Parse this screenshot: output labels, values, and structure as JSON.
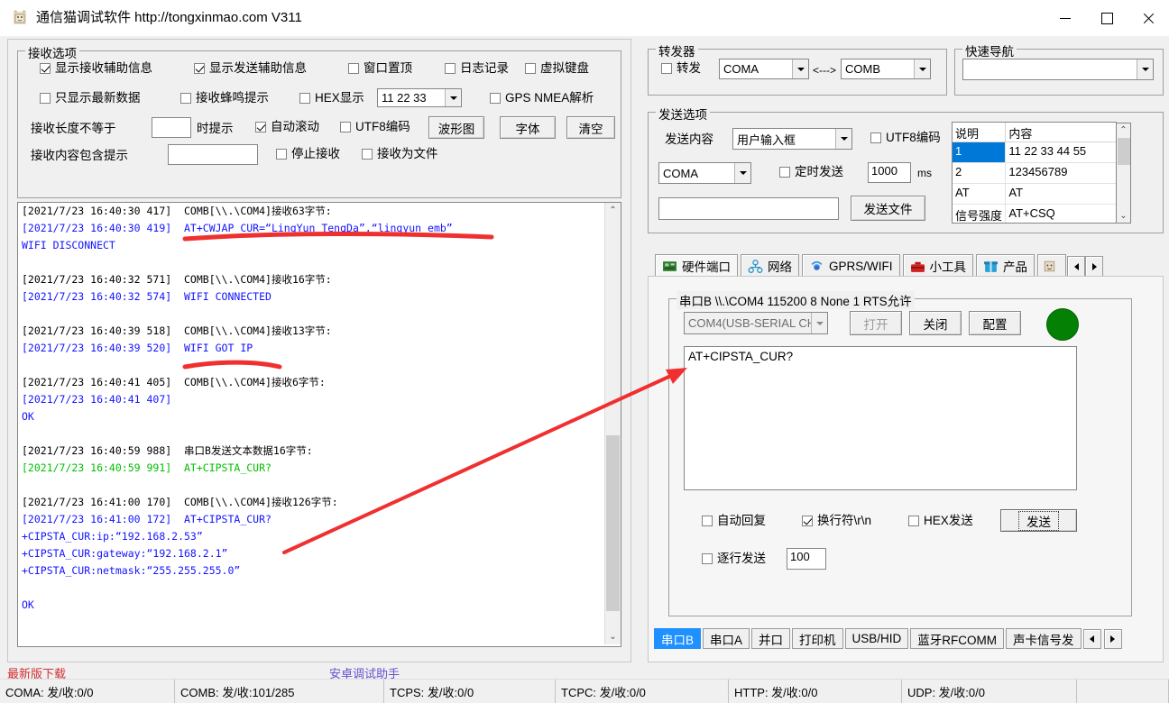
{
  "window": {
    "title": "通信猫调试软件 http://tongxinmao.com V311",
    "icon": "app-cat-icon",
    "minimize": "—",
    "maximize": "□",
    "close": "✕"
  },
  "receive_options": {
    "legend": "接收选项",
    "checkboxes_row1": [
      {
        "label": "显示接收辅助信息",
        "checked": true
      },
      {
        "label": "显示发送辅助信息",
        "checked": true
      },
      {
        "label": "窗口置顶",
        "checked": false
      },
      {
        "label": "日志记录",
        "checked": false
      },
      {
        "label": "虚拟键盘",
        "checked": false
      }
    ],
    "checkboxes_row2": [
      {
        "label": "只显示最新数据",
        "checked": false
      },
      {
        "label": "接收蜂鸣提示",
        "checked": false
      },
      {
        "label": "HEX显示",
        "checked": false
      },
      {
        "label": "GPS NMEA解析",
        "checked": false
      }
    ],
    "hex_combo_value": "11 22 33",
    "row3": {
      "len_label_before": "接收长度不等于",
      "len_value": "",
      "len_label_after": "时提示",
      "autoscroll": {
        "label": "自动滚动",
        "checked": true
      },
      "utf8": {
        "label": "UTF8编码",
        "checked": false
      },
      "btn_wave": "波形图",
      "btn_font": "字体",
      "btn_clear": "清空"
    },
    "row4": {
      "contains_label": "接收内容包含提示",
      "contains_value": "",
      "stop_recv": {
        "label": "停止接收",
        "checked": false
      },
      "recv_to_file": {
        "label": "接收为文件",
        "checked": false
      }
    }
  },
  "log": {
    "lines": [
      {
        "text": "[2021/7/23 16:40:30 417]  COMB[\\\\.\\COM4]接收63字节:",
        "color": "black"
      },
      {
        "text": "[2021/7/23 16:40:30 419]  AT+CWJAP_CUR=“LingYun_TengDa”,“lingyun_emb”",
        "color": "blue"
      },
      {
        "text": "WIFI DISCONNECT",
        "color": "blue"
      },
      {
        "text": "",
        "color": "black"
      },
      {
        "text": "[2021/7/23 16:40:32 571]  COMB[\\\\.\\COM4]接收16字节:",
        "color": "black"
      },
      {
        "text": "[2021/7/23 16:40:32 574]  WIFI CONNECTED",
        "color": "blue"
      },
      {
        "text": "",
        "color": "black"
      },
      {
        "text": "[2021/7/23 16:40:39 518]  COMB[\\\\.\\COM4]接收13字节:",
        "color": "black"
      },
      {
        "text": "[2021/7/23 16:40:39 520]  WIFI GOT IP",
        "color": "blue"
      },
      {
        "text": "",
        "color": "black"
      },
      {
        "text": "[2021/7/23 16:40:41 405]  COMB[\\\\.\\COM4]接收6字节:",
        "color": "black"
      },
      {
        "text": "[2021/7/23 16:40:41 407]",
        "color": "blue"
      },
      {
        "text": "OK",
        "color": "blue"
      },
      {
        "text": "",
        "color": "black"
      },
      {
        "text": "[2021/7/23 16:40:59 988]  串口B发送文本数据16字节:",
        "color": "black"
      },
      {
        "text": "[2021/7/23 16:40:59 991]  AT+CIPSTA_CUR?",
        "color": "green"
      },
      {
        "text": "",
        "color": "black"
      },
      {
        "text": "[2021/7/23 16:41:00 170]  COMB[\\\\.\\COM4]接收126字节:",
        "color": "black"
      },
      {
        "text": "[2021/7/23 16:41:00 172]  AT+CIPSTA_CUR?",
        "color": "blue"
      },
      {
        "text": "+CIPSTA_CUR:ip:“192.168.2.53”",
        "color": "blue"
      },
      {
        "text": "+CIPSTA_CUR:gateway:“192.168.2.1”",
        "color": "blue"
      },
      {
        "text": "+CIPSTA_CUR:netmask:“255.255.255.0”",
        "color": "blue"
      },
      {
        "text": "",
        "color": "black"
      },
      {
        "text": "OK",
        "color": "blue"
      }
    ]
  },
  "forwarder": {
    "legend": "转发器",
    "checkbox": {
      "label": "转发",
      "checked": false
    },
    "port_a": "COMA",
    "arrow": "<--->",
    "port_b": "COMB"
  },
  "quick_nav": {
    "legend": "快速导航",
    "value": ""
  },
  "send_options": {
    "legend": "发送选项",
    "content_label": "发送内容",
    "content_value": "用户输入框",
    "utf8": {
      "label": "UTF8编码",
      "checked": false
    },
    "port_value": "COMA",
    "timed": {
      "label": "定时发送",
      "checked": false
    },
    "interval_value": "1000",
    "interval_unit": "ms",
    "file_path": "",
    "btn_send_file": "发送文件"
  },
  "shortcut_table": {
    "headers": [
      "说明",
      "内容"
    ],
    "rows": [
      {
        "desc": "1",
        "content": "11 22 33 44 55",
        "selected": true
      },
      {
        "desc": "2",
        "content": "123456789",
        "selected": false
      },
      {
        "desc": "AT",
        "content": "AT",
        "selected": false
      },
      {
        "desc": "信号强度",
        "content": "AT+CSQ",
        "selected": false
      },
      {
        "desc": "",
        "content": "",
        "selected": false
      }
    ]
  },
  "top_tabs": {
    "items": [
      {
        "label": "硬件端口",
        "icon": "circuit-board-icon",
        "active": true
      },
      {
        "label": "网络",
        "icon": "network-icon",
        "active": false
      },
      {
        "label": "GPRS/WIFI",
        "icon": "wireless-icon",
        "active": false
      },
      {
        "label": "小工具",
        "icon": "toolbox-icon",
        "active": false
      },
      {
        "label": "产品",
        "icon": "product-box-icon",
        "active": false
      },
      {
        "label": "",
        "icon": "cat-icon",
        "active": false
      }
    ],
    "scroll_left": "◄",
    "scroll_right": "►"
  },
  "serial_panel": {
    "legend": "串口B \\\\.\\COM4 115200 8  None  1 RTS允许",
    "port_combo": "COM4(USB-SERIAL CH",
    "btn_open": "打开",
    "btn_close": "关闭",
    "btn_config": "配置",
    "led_color": "#048004",
    "send_text": "AT+CIPSTA_CUR?",
    "auto_reply": {
      "label": "自动回复",
      "checked": false
    },
    "newline": {
      "label": "换行符\\r\\n",
      "checked": true
    },
    "hex_send": {
      "label": "HEX发送",
      "checked": false
    },
    "btn_send": "发送",
    "line_by_line": {
      "label": "逐行发送",
      "checked": false
    },
    "line_delay": "100"
  },
  "bottom_tabs": {
    "items": [
      {
        "label": "串口B",
        "active": true
      },
      {
        "label": "串口A",
        "active": false
      },
      {
        "label": "并口",
        "active": false
      },
      {
        "label": "打印机",
        "active": false
      },
      {
        "label": "USB/HID",
        "active": false
      },
      {
        "label": "蓝牙RFCOMM",
        "active": false
      },
      {
        "label": "声卡信号发",
        "active": false
      }
    ],
    "scroll_left": "◄",
    "scroll_right": "►"
  },
  "links": {
    "download": "最新版下载",
    "download_color": "#d13030",
    "android": "安卓调试助手",
    "android_color": "#6a4fd0"
  },
  "status_bar": {
    "cells": [
      "COMA: 发/收:0/0",
      "COMB: 发/收:101/285",
      "TCPS: 发/收:0/0",
      "TCPC: 发/收:0/0",
      "HTTP: 发/收:0/0",
      "UDP: 发/收:0/0",
      ""
    ]
  },
  "annotations": {
    "accent_color": "#f03030",
    "underline_1": "AT+CWJAP_CUR line underline",
    "underline_2": "WIFI GOT IP underline",
    "arrow": "points from log AT+CIPSTA_CUR to send textbox"
  }
}
